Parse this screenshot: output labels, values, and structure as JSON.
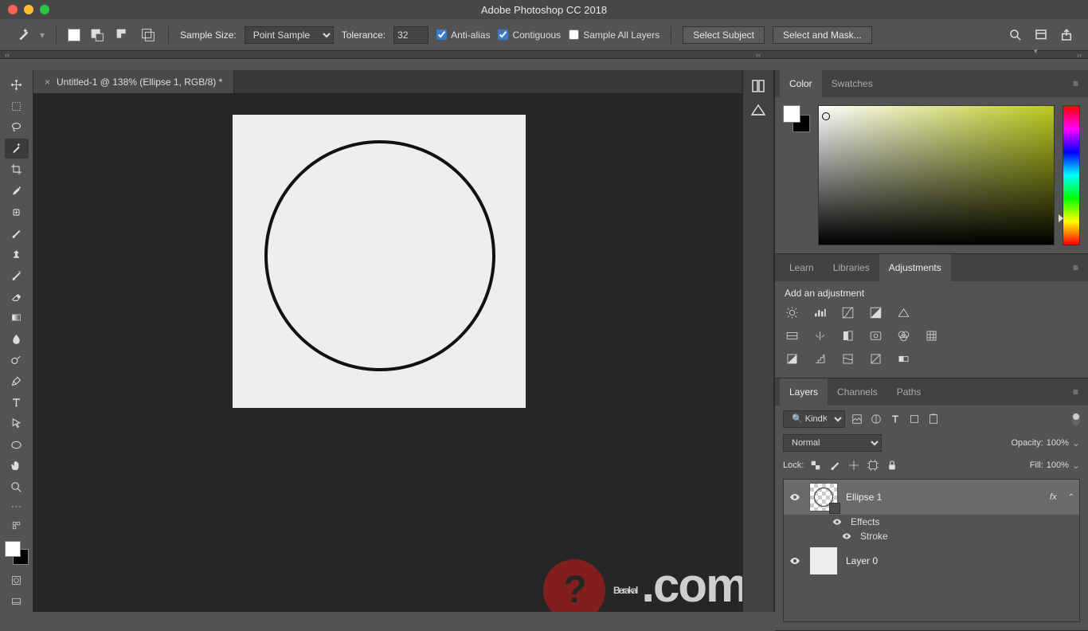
{
  "titlebar": {
    "title": "Adobe Photoshop CC 2018"
  },
  "options": {
    "sample_size_label": "Sample Size:",
    "sample_size_value": "Point Sample",
    "tolerance_label": "Tolerance:",
    "tolerance_value": "32",
    "anti_alias": "Anti-alias",
    "contiguous": "Contiguous",
    "sample_all": "Sample All Layers",
    "select_subject": "Select Subject",
    "select_mask": "Select and Mask..."
  },
  "document": {
    "tab": "Untitled-1 @ 138% (Ellipse 1, RGB/8) *"
  },
  "panels": {
    "color_tab": "Color",
    "swatches_tab": "Swatches",
    "learn_tab": "Learn",
    "libraries_tab": "Libraries",
    "adjustments_tab": "Adjustments",
    "add_adjustment": "Add an adjustment",
    "layers_tab": "Layers",
    "channels_tab": "Channels",
    "paths_tab": "Paths"
  },
  "layers": {
    "kind": "Kind",
    "blend": "Normal",
    "opacity_label": "Opacity:",
    "opacity_value": "100%",
    "lock_label": "Lock:",
    "fill_label": "Fill:",
    "fill_value": "100%",
    "item1": "Ellipse 1",
    "item1_effects": "Effects",
    "item1_stroke": "Stroke",
    "item2": "Layer 0",
    "fx": "fx"
  },
  "watermark": {
    "text": "Berakal",
    "suffix": ".com"
  }
}
